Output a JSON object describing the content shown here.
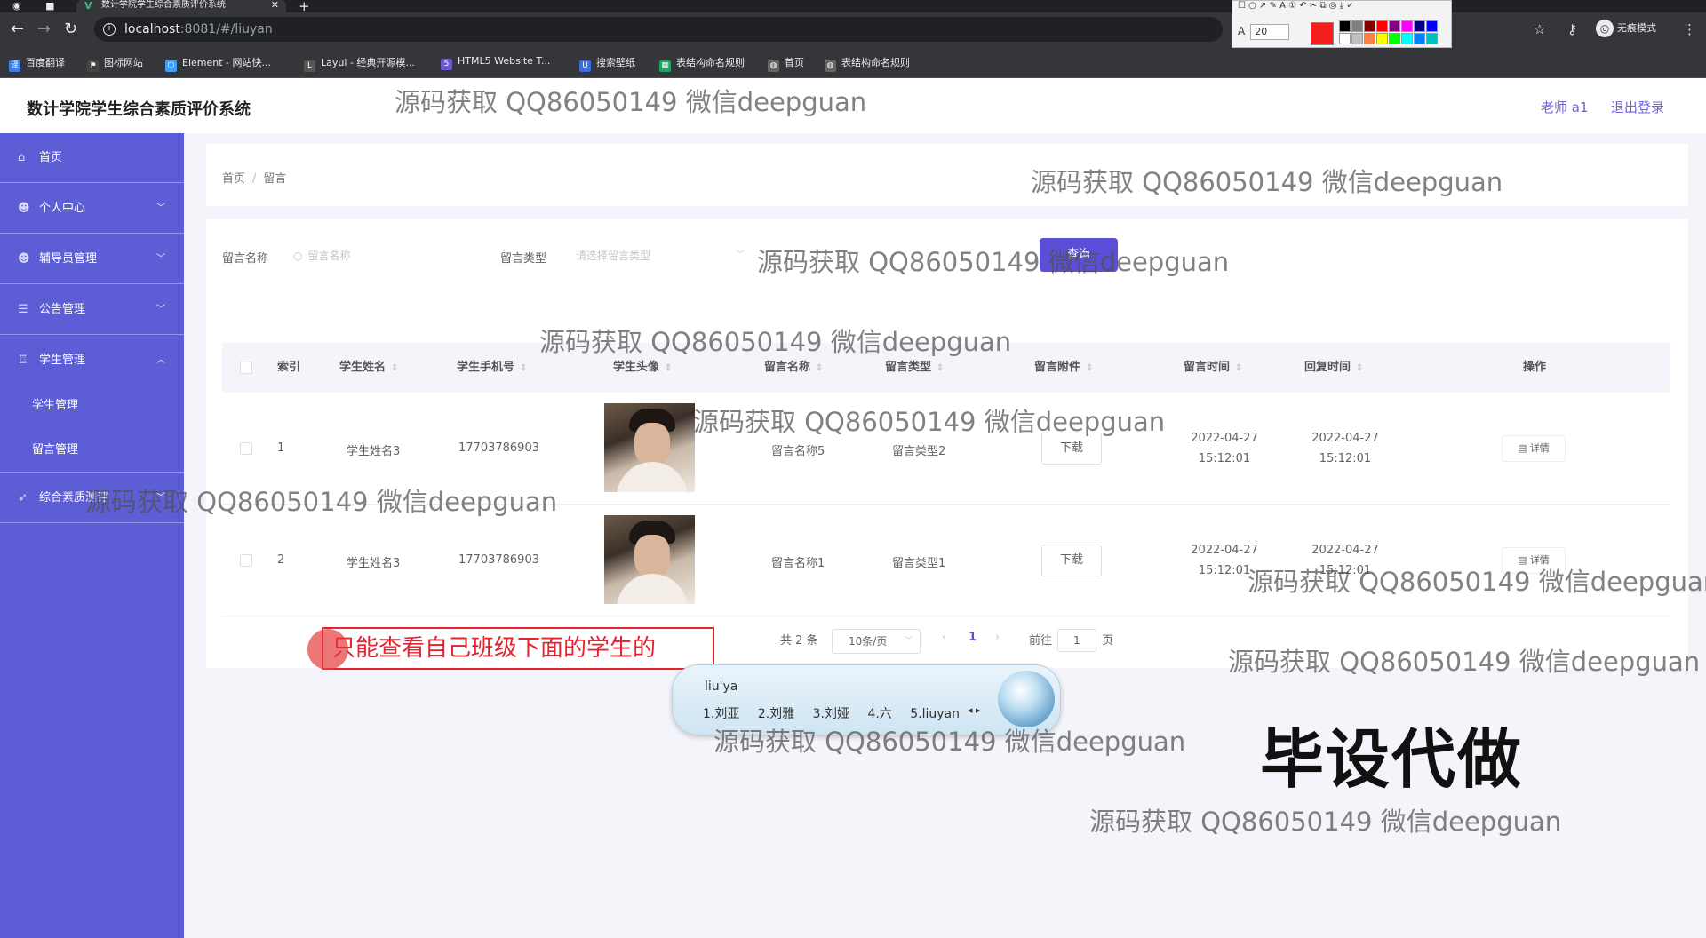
{
  "browser": {
    "tab_title": "数计学院学生综合素质评价系统",
    "tab_close_glyph": "✕",
    "new_tab_glyph": "+",
    "url_host": "localhost",
    "url_rest": ":8081/#/liuyan",
    "incognito_label": "无痕模式",
    "bookmarks": [
      {
        "label": "百度翻译",
        "icon": "translate-icon",
        "color": "#3c7ee9"
      },
      {
        "label": "图标网站",
        "icon": "flag-icon",
        "color": "#444444"
      },
      {
        "label": "Element - 网站快...",
        "icon": "element-icon",
        "color": "#409eff"
      },
      {
        "label": "Layui - 经典开源模...",
        "icon": "layui-icon",
        "color": "#555555"
      },
      {
        "label": "HTML5 Website T...",
        "icon": "html5-icon",
        "color": "#6a5acd"
      },
      {
        "label": "搜索壁纸",
        "icon": "wallpaper-icon",
        "color": "#3a6ee0"
      },
      {
        "label": "表结构命名规则",
        "icon": "sheet-icon",
        "color": "#1fa463"
      },
      {
        "label": "首页",
        "icon": "globe-icon",
        "color": "#666666"
      },
      {
        "label": "表结构命名规则",
        "icon": "globe-icon",
        "color": "#666666"
      }
    ]
  },
  "annotation_tool": {
    "font_label": "A",
    "font_size": "20",
    "active_color": "#f41e1e",
    "swatches": [
      "#000000",
      "#808080",
      "#800000",
      "#ff0000",
      "#800080",
      "#ff00ff",
      "#000080",
      "#0000ff",
      "#ffffff",
      "#c0c0c0",
      "#ff8040",
      "#ffff00",
      "#00ff00",
      "#00ffff",
      "#0080ff",
      "#00c0c0"
    ]
  },
  "header": {
    "title": "数计学院学生综合素质评价系统",
    "user": "老师 a1",
    "logout": "退出登录"
  },
  "sidebar": {
    "items": [
      {
        "label": "首页",
        "icon": "home-icon",
        "glyph": "⌂",
        "chevron": ""
      },
      {
        "label": "个人中心",
        "icon": "user-icon",
        "glyph": "☻",
        "chevron": "﹀"
      },
      {
        "label": "辅导员管理",
        "icon": "user-icon",
        "glyph": "☻",
        "chevron": "﹀"
      },
      {
        "label": "公告管理",
        "icon": "list-icon",
        "glyph": "☰",
        "chevron": "﹀"
      },
      {
        "label": "学生管理",
        "icon": "cup-icon",
        "glyph": "♖",
        "chevron": "︿"
      }
    ],
    "sub_items": [
      "学生管理",
      "留言管理"
    ],
    "extra": {
      "label": "综合素质测评",
      "icon": "send-icon",
      "glyph": "➶",
      "chevron": "﹀"
    }
  },
  "breadcrumb": {
    "home": "首页",
    "separator": "/",
    "current": "留言"
  },
  "filters": {
    "name_label": "留言名称",
    "name_placeholder": "留言名称",
    "type_label": "留言类型",
    "type_placeholder": "请选择留言类型",
    "query_button": "查询"
  },
  "table": {
    "columns": [
      "索引",
      "学生姓名",
      "学生手机号",
      "学生头像",
      "留言名称",
      "留言类型",
      "留言附件",
      "留言时间",
      "回复时间",
      "操作"
    ],
    "rows": [
      {
        "index": "1",
        "name": "学生姓名3",
        "phone": "17703786903",
        "title": "留言名称5",
        "type": "留言类型2",
        "attachment": "下载",
        "msg_time": "2022-04-27 15:12:01",
        "reply_time": "2022-04-27 15:12:01",
        "action": "详情"
      },
      {
        "index": "2",
        "name": "学生姓名3",
        "phone": "17703786903",
        "title": "留言名称1",
        "type": "留言类型1",
        "attachment": "下载",
        "msg_time": "2022-04-27 15:12:01",
        "reply_time": "2022-04-27 15:12:01",
        "action": "详情"
      }
    ]
  },
  "pagination": {
    "total": "共 2 条",
    "page_size": "10条/页",
    "prev": "‹",
    "current": "1",
    "next": "›",
    "goto_label": "前往",
    "goto_value": "1",
    "goto_suffix": "页"
  },
  "annotation": {
    "text": "只能查看自己班级下面的学生的"
  },
  "ime": {
    "composition": "liu'ya",
    "candidates": [
      "1.刘亚",
      "2.刘雅",
      "3.刘娅",
      "4.六",
      "5.liuyan"
    ],
    "arrows": "◂ ▸"
  },
  "stamp": {
    "text": "毕设代做"
  },
  "watermark": {
    "text": "源码获取 QQ86050149 微信deepguan"
  }
}
